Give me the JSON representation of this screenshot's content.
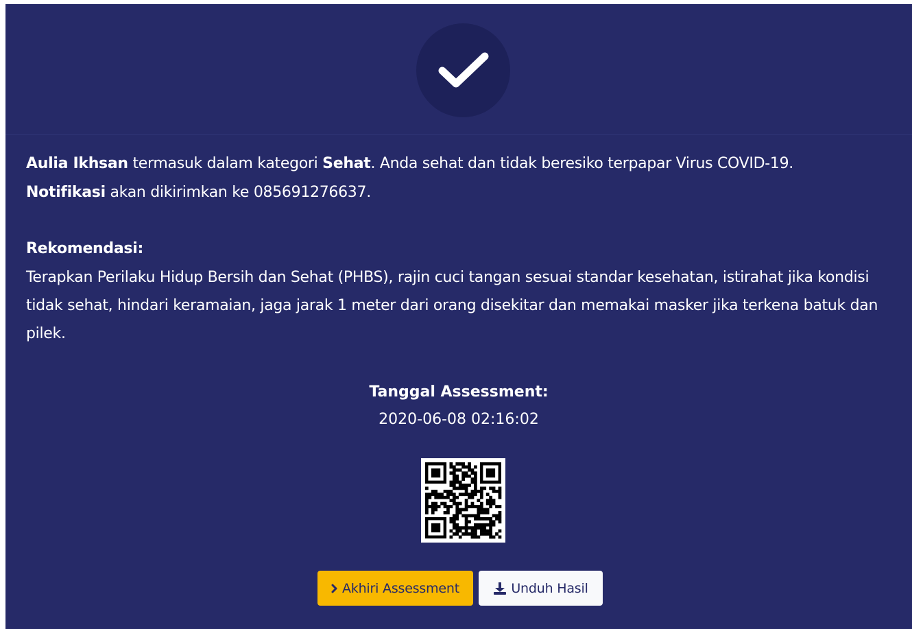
{
  "result": {
    "name": "Aulia Ikhsan",
    "text_category_prefix": " termasuk dalam kategori ",
    "category": "Sehat",
    "text_category_suffix": ". Anda sehat dan tidak beresiko terpapar Virus COVID-19.",
    "notification_label": "Notifikasi",
    "notification_text": " akan dikirimkan ke 085691276637."
  },
  "recommendation": {
    "title": "Rekomendasi:",
    "text": "Terapkan Perilaku Hidup Bersih dan Sehat (PHBS), rajin cuci tangan sesuai standar kesehatan, istirahat jika kondisi tidak sehat, hindari keramaian, jaga jarak 1 meter dari orang disekitar dan memakai masker jika terkena batuk dan pilek."
  },
  "assessment": {
    "date_label": "Tanggal Assessment:",
    "date_value": "2020-06-08 02:16:02"
  },
  "buttons": {
    "finish_label": "Akhiri Assessment",
    "download_label": "Unduh Hasil"
  },
  "icons": {
    "status": "check-icon",
    "finish": "chevron-right-icon",
    "download": "download-icon",
    "qr": "qr-code"
  },
  "colors": {
    "background": "#262a68",
    "status_circle": "#1d2159",
    "primary_button": "#f8b800",
    "secondary_button": "#f8f9fb",
    "text": "#ffffff"
  }
}
